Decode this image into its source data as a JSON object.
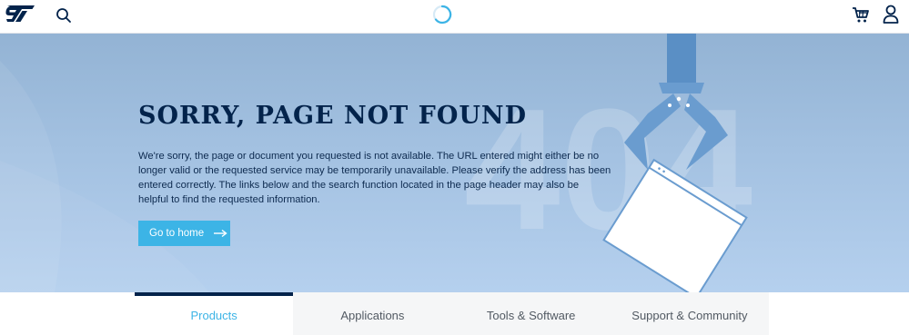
{
  "header": {
    "logo_icon": "st-logo-icon",
    "search_icon": "search-icon",
    "spinner_icon": "loading-spinner-icon",
    "cart_icon": "cart-icon",
    "user_icon": "user-icon"
  },
  "hero": {
    "bg_text": "404",
    "title": "SORRY, PAGE NOT FOUND",
    "message": "We're sorry, the page or document you requested is not available. The URL entered might either be no longer valid or the requested service may be temporarily unavailable. Please verify the address has been entered correctly. The links below and the search function located in the page header may also be helpful to find the requested information.",
    "home_button": "Go to home",
    "illustration_icon": "claw-holding-document-illustration"
  },
  "tabs": [
    {
      "label": "Products",
      "active": true
    },
    {
      "label": "Applications",
      "active": false
    },
    {
      "label": "Tools & Software",
      "active": false
    },
    {
      "label": "Support & Community",
      "active": false
    }
  ],
  "colors": {
    "brand_navy": "#03234b",
    "accent_blue": "#3cb4e6",
    "hero_bg": "#a3c1e1"
  }
}
